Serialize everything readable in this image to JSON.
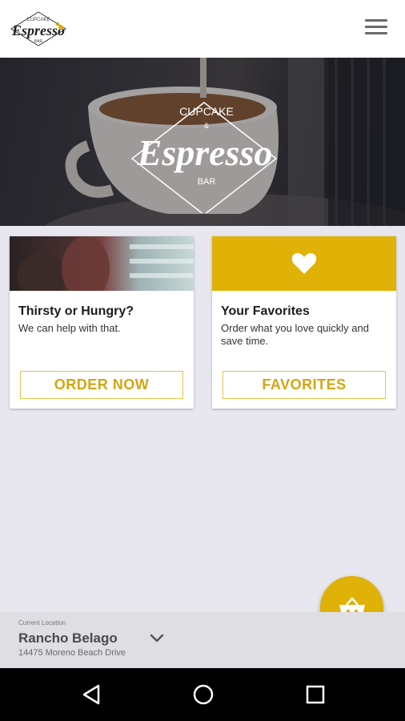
{
  "header": {
    "logo": {
      "line1": "CUPCAKE",
      "line2": "&",
      "line3": "Espresso",
      "line4": "BAR"
    },
    "menu_icon": "hamburger-menu-icon"
  },
  "hero": {
    "logo": {
      "top": "CUPCAKE",
      "amp": "&",
      "main": "Espresso",
      "bottom": "BAR"
    }
  },
  "cards": [
    {
      "title": "Thirsty or Hungry?",
      "subtitle": "We can help with that.",
      "button_label": "ORDER NOW"
    },
    {
      "icon": "heart-icon",
      "title": "Your Favorites",
      "subtitle": "Order what you love quickly and save time.",
      "button_label": "FAVORITES"
    }
  ],
  "cart_fab": {
    "icon": "basket-icon"
  },
  "location": {
    "caption": "Current Location",
    "name": "Rancho Belago",
    "address": "14475 Moreno Beach Drive"
  },
  "colors": {
    "accent": "#e0b107",
    "button_text": "#d4a512",
    "background": "#e8e7ef",
    "nav_bar": "#000000"
  },
  "system_nav": {
    "back": "back-triangle-icon",
    "home": "home-circle-icon",
    "recents": "recents-square-icon"
  }
}
